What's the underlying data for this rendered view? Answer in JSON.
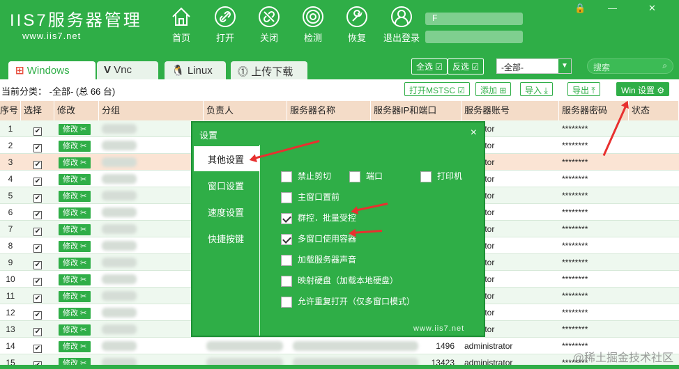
{
  "brand": {
    "name": "IIS7服务器管理",
    "url": "www.iis7.net"
  },
  "nav": [
    {
      "label": "首页",
      "icon": "home-icon"
    },
    {
      "label": "打开",
      "icon": "link-icon"
    },
    {
      "label": "关闭",
      "icon": "unlink-icon"
    },
    {
      "label": "检测",
      "icon": "radar-icon"
    },
    {
      "label": "恢复",
      "icon": "wrench-icon"
    },
    {
      "label": "退出登录",
      "icon": "user-icon"
    }
  ],
  "header_user": {
    "line1": "F"
  },
  "window_controls": {
    "lock": "🔒",
    "minimize": "—",
    "close": "✕"
  },
  "tabs": [
    {
      "label": "Windows",
      "active": true
    },
    {
      "label": "Vnc",
      "active": false
    },
    {
      "label": "Linux",
      "active": false
    },
    {
      "label": "上传下载",
      "active": false
    }
  ],
  "toolbar": {
    "select_all": "全选",
    "invert_select": "反选",
    "group_select": "-全部-",
    "search_placeholder": "搜索"
  },
  "category": {
    "text": "当前分类： -全部- (总 66 台)"
  },
  "actions": {
    "open_mstsc": "打开MSTSC",
    "add": "添加",
    "import": "导入",
    "export": "导出",
    "win_settings": "Win  设置"
  },
  "table": {
    "headers": [
      "序号",
      "选择",
      "修改",
      "分组",
      "负责人",
      "服务器名称",
      "服务器IP和端口",
      "服务器账号",
      "服务器密码",
      "状态"
    ],
    "edit_label": "修改",
    "rows": [
      {
        "no": "1",
        "account": "nistrator",
        "password": "********"
      },
      {
        "no": "2",
        "account": "nistrator",
        "password": "********"
      },
      {
        "no": "3",
        "account": "nistrator",
        "password": "********"
      },
      {
        "no": "4",
        "account": "nistrator",
        "password": "********"
      },
      {
        "no": "5",
        "account": "nistrator",
        "password": "********"
      },
      {
        "no": "6",
        "account": "nistrator",
        "password": "********"
      },
      {
        "no": "7",
        "account": "nistrator",
        "password": "********"
      },
      {
        "no": "8",
        "account": "nistrator",
        "password": "********"
      },
      {
        "no": "9",
        "account": "nistrator",
        "password": "********"
      },
      {
        "no": "10",
        "account": "nistrator",
        "password": "********"
      },
      {
        "no": "11",
        "account": "nistrator",
        "password": "********"
      },
      {
        "no": "12",
        "account": "nistrator",
        "password": "********"
      },
      {
        "no": "13",
        "account": "nistrator",
        "password": "********"
      },
      {
        "no": "14",
        "ip_tail": "1496",
        "account": "administrator",
        "password": "********"
      },
      {
        "no": "15",
        "ip_tail": "13423",
        "account": "administrator",
        "password": "********"
      }
    ]
  },
  "dialog": {
    "title": "设置",
    "close": "×",
    "sidebar": [
      "其他设置",
      "窗口设置",
      "速度设置",
      "快捷按键"
    ],
    "options": [
      {
        "label": "禁止剪切",
        "checked": false
      },
      {
        "label": "端口",
        "checked": false
      },
      {
        "label": "打印机",
        "checked": false
      },
      {
        "label": "主窗口置前",
        "checked": false
      },
      {
        "label": "群控．批量受控",
        "checked": true
      },
      {
        "label": "多窗口使用容器",
        "checked": true
      },
      {
        "label": "加载服务器声音",
        "checked": false
      },
      {
        "label": "映射硬盘（加载本地硬盘）",
        "checked": false
      },
      {
        "label": "允许重复打开（仅多窗口模式）",
        "checked": false
      }
    ],
    "footer": "www.iis7.net"
  },
  "watermark": "@稀土掘金技术社区",
  "colors": {
    "brand_green": "#2fae47",
    "header_row": "#f4dcc8",
    "arrow_red": "#e8302f"
  }
}
